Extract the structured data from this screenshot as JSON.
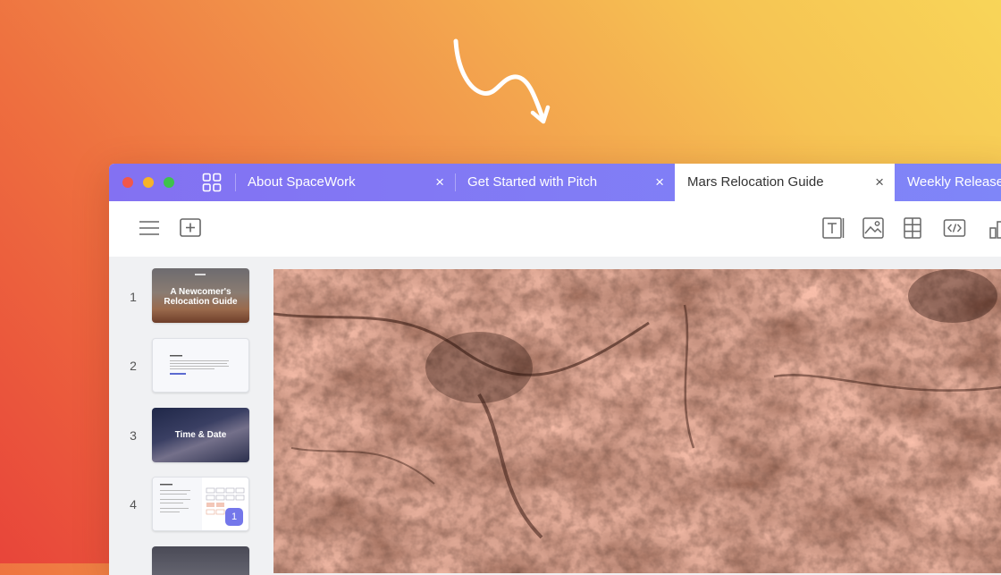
{
  "window": {
    "tabs": [
      {
        "label": "About SpaceWork",
        "active": false
      },
      {
        "label": "Get Started with Pitch",
        "active": false
      },
      {
        "label": "Mars Relocation Guide",
        "active": true
      },
      {
        "label": "Weekly Release |",
        "active": false
      }
    ],
    "close_glyph": "×"
  },
  "toolbar": {
    "left_icons": [
      "menu-icon",
      "add-slide-icon"
    ],
    "right_icons": [
      "text-icon",
      "image-icon",
      "table-icon",
      "embed-code-icon",
      "chart-icon"
    ]
  },
  "slides": [
    {
      "number": "1",
      "title_line1": "A Newcomer's",
      "title_line2": "Relocation Guide"
    },
    {
      "number": "2"
    },
    {
      "number": "3",
      "title": "Time & Date"
    },
    {
      "number": "4",
      "badge": "1"
    }
  ],
  "colors": {
    "tabbar": "#8371f2",
    "accent": "#7477ea",
    "canvas_rock": "#7d3f2e"
  }
}
